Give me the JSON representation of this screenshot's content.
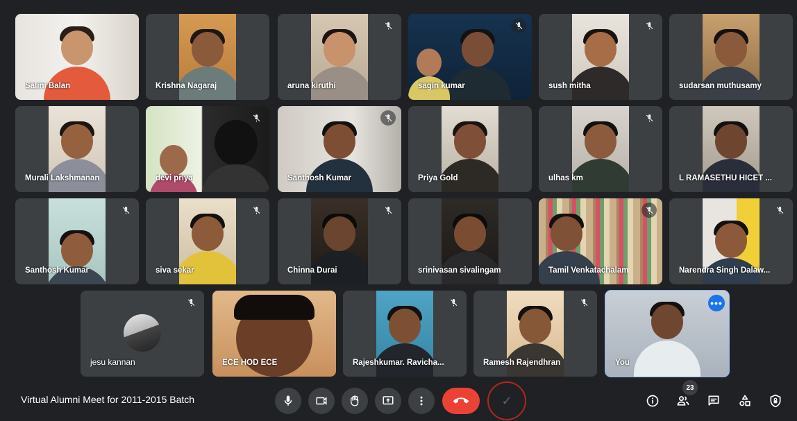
{
  "participants_row1": [
    {
      "name": "Salini Balan",
      "muted": false
    },
    {
      "name": "Krishna Nagaraj",
      "muted": false
    },
    {
      "name": "aruna kiruthi",
      "muted": true
    },
    {
      "name": "sagin kumar",
      "muted": true
    },
    {
      "name": "sush mitha",
      "muted": true
    },
    {
      "name": "sudarsan muthusamy",
      "muted": false
    }
  ],
  "participants_row2": [
    {
      "name": "Murali Lakshmanan",
      "muted": false
    },
    {
      "name": "devi priya",
      "muted": true
    },
    {
      "name": "Santhosh Kumar",
      "muted": true
    },
    {
      "name": "Priya Gold",
      "muted": false
    },
    {
      "name": "ulhas km",
      "muted": true
    },
    {
      "name": "L RAMASETHU HICET ...",
      "muted": false
    }
  ],
  "participants_row3": [
    {
      "name": "Santhosh Kumar",
      "muted": true
    },
    {
      "name": "siva sekar",
      "muted": true
    },
    {
      "name": "Chinna Durai",
      "muted": true
    },
    {
      "name": "srinivasan sivalingam",
      "muted": false
    },
    {
      "name": "Tamil Venkatachalam",
      "muted": true
    },
    {
      "name": "Narendra Singh Dalaw...",
      "muted": true
    }
  ],
  "participants_row4": [
    {
      "name": "jesu kannan",
      "muted": true
    },
    {
      "name": "ECE HOD ECE",
      "muted": false
    },
    {
      "name": "Rajeshkumar. Ravicha...",
      "muted": true
    },
    {
      "name": "Ramesh Rajendhran",
      "muted": true
    },
    {
      "name": "You",
      "muted": false
    }
  ],
  "self_more_label": "•••",
  "meeting": {
    "title": "Virtual Alumni Meet for 2011-2015 Batch"
  },
  "people_count": "23",
  "icons": {
    "mic": "mic-icon",
    "camera": "camera-icon",
    "hand": "raise-hand-icon",
    "present": "present-icon",
    "more": "more-vert-icon",
    "end": "end-call-icon",
    "info": "info-icon",
    "people": "people-icon",
    "chat": "chat-icon",
    "activities": "activities-icon",
    "host": "host-controls-icon"
  },
  "colors": {
    "background": "#202124",
    "tile": "#3c4043",
    "end_call": "#ea4335",
    "accent": "#1a73e8"
  }
}
